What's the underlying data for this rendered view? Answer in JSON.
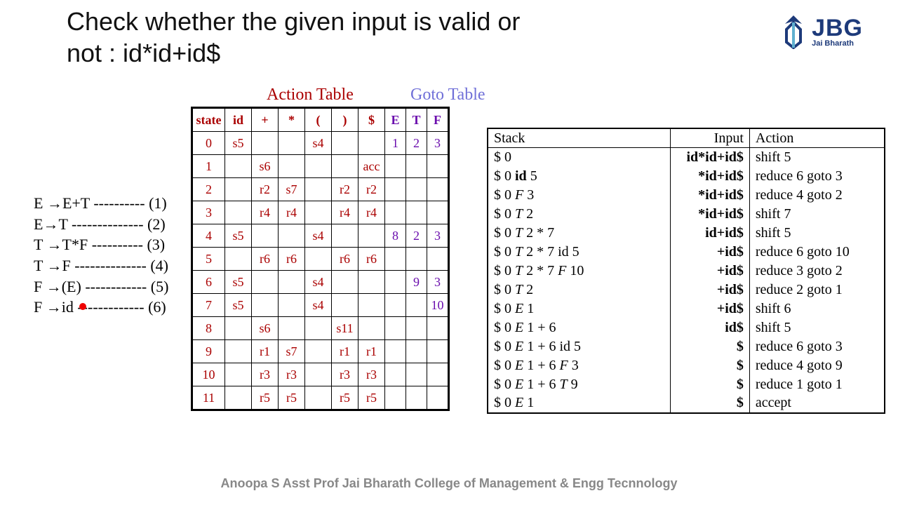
{
  "title_line1": "Check whether the given input is valid or",
  "title_line2": "not  : id*id+id$",
  "logo": {
    "big": "JBG",
    "small": "Jai Bharath"
  },
  "action_title": "Action Table",
  "goto_title": "Goto Table",
  "grammar": [
    "E →E+T ---------- (1)",
    "E→T -------------- (2)",
    "T →T*F ---------- (3)",
    "T →F -------------- (4)",
    "F →(E) ------------ (5)",
    "F →id ------------- (6)"
  ],
  "parse_headers": [
    "state",
    "id",
    "+",
    "*",
    "(",
    ")",
    "$",
    "E",
    "T",
    "F"
  ],
  "parse_rows": [
    [
      "0",
      "s5",
      "",
      "",
      "s4",
      "",
      "",
      "1",
      "2",
      "3"
    ],
    [
      "1",
      "",
      "s6",
      "",
      "",
      "",
      "acc",
      "",
      "",
      ""
    ],
    [
      "2",
      "",
      "r2",
      "s7",
      "",
      "r2",
      "r2",
      "",
      "",
      ""
    ],
    [
      "3",
      "",
      "r4",
      "r4",
      "",
      "r4",
      "r4",
      "",
      "",
      ""
    ],
    [
      "4",
      "s5",
      "",
      "",
      "s4",
      "",
      "",
      "8",
      "2",
      "3"
    ],
    [
      "5",
      "",
      "r6",
      "r6",
      "",
      "r6",
      "r6",
      "",
      "",
      ""
    ],
    [
      "6",
      "s5",
      "",
      "",
      "s4",
      "",
      "",
      "",
      "9",
      "3"
    ],
    [
      "7",
      "s5",
      "",
      "",
      "s4",
      "",
      "",
      "",
      "",
      "10"
    ],
    [
      "8",
      "",
      "s6",
      "",
      "",
      "s11",
      "",
      "",
      "",
      ""
    ],
    [
      "9",
      "",
      "r1",
      "s7",
      "",
      "r1",
      "r1",
      "",
      "",
      ""
    ],
    [
      "10",
      "",
      "r3",
      "r3",
      "",
      "r3",
      "r3",
      "",
      "",
      ""
    ],
    [
      "11",
      "",
      "r5",
      "r5",
      "",
      "r5",
      "r5",
      "",
      "",
      ""
    ]
  ],
  "trace_headers": {
    "stack": "Stack",
    "input": "Input",
    "action": "Action"
  },
  "trace_rows": [
    {
      "stack": "$ 0",
      "input": "id*id+id$",
      "action": "shift 5",
      "input_bold": true
    },
    {
      "stack": "$ 0 id 5",
      "input": "*id+id$",
      "action": "reduce 6 goto 3",
      "stack_bold": "id",
      "input_bold": true
    },
    {
      "stack": "$ 0 F 3",
      "input": "*id+id$",
      "action": "reduce 4 goto 2",
      "stack_italic": "F",
      "input_bold": true
    },
    {
      "stack": "$ 0 T 2",
      "input": "*id+id$",
      "action": "shift 7",
      "stack_italic": "T",
      "input_bold": true
    },
    {
      "stack": "$ 0 T 2 * 7",
      "input": "id+id$",
      "action": "shift 5",
      "stack_italic": "T",
      "input_bold": true
    },
    {
      "stack": "$ 0 T 2 * 7 id 5",
      "input": "+id$",
      "action": "reduce 6 goto 10",
      "stack_italic": "T",
      "input_bold": true
    },
    {
      "stack": "$ 0 T 2 * 7 F 10",
      "input": "+id$",
      "action": "reduce 3 goto 2",
      "stack_italic": "T F",
      "input_bold": true
    },
    {
      "stack": "$ 0 T 2",
      "input": "+id$",
      "action": "reduce 2 goto 1",
      "stack_italic": "T",
      "input_bold": true
    },
    {
      "stack": "$ 0 E 1",
      "input": "+id$",
      "action": "shift 6",
      "stack_italic": "E",
      "input_bold": true
    },
    {
      "stack": "$ 0 E 1 + 6",
      "input": "id$",
      "action": "shift 5",
      "stack_italic": "E",
      "input_bold": true
    },
    {
      "stack": "$ 0 E 1 + 6 id 5",
      "input": "$",
      "action": "reduce 6 goto 3",
      "stack_italic": "E",
      "input_bold": true
    },
    {
      "stack": "$ 0 E 1 + 6 F 3",
      "input": "$",
      "action": "reduce 4 goto 9",
      "stack_italic": "E F",
      "input_bold": true
    },
    {
      "stack": "$ 0 E 1 + 6 T 9",
      "input": "$",
      "action": "reduce 1 goto 1",
      "stack_italic": "E T",
      "input_bold": true
    },
    {
      "stack": "$ 0 E 1",
      "input": "$",
      "action": "accept",
      "stack_italic": "E",
      "input_bold": true
    }
  ],
  "footer": "Anoopa S    Asst Prof       Jai Bharath College of Management & Engg  Tecnnology"
}
